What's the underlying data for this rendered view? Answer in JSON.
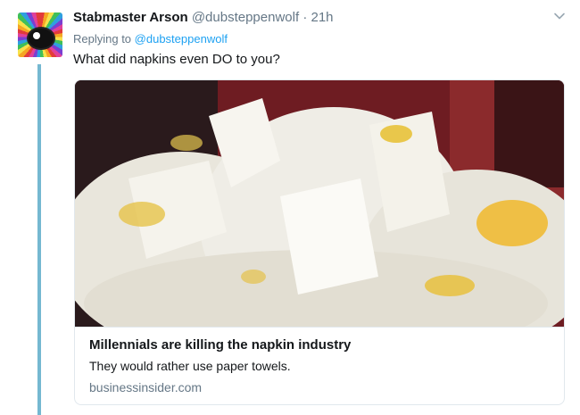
{
  "tweet": {
    "display_name": "Stabmaster Arson",
    "handle": "@dubsteppenwolf",
    "separator": "·",
    "time": "21h",
    "reply_prefix": "Replying to",
    "reply_to": "@dubsteppenwolf",
    "text": "What did napkins even DO to you?"
  },
  "card": {
    "title": "Millennials are killing the napkin industry",
    "description": "They would rather use paper towels.",
    "domain": "businessinsider.com"
  },
  "icons": {
    "menu": "chevron-down-icon"
  },
  "colors": {
    "accent": "#1da1f2",
    "thread_line": "#75b8d1",
    "muted": "#657786"
  }
}
